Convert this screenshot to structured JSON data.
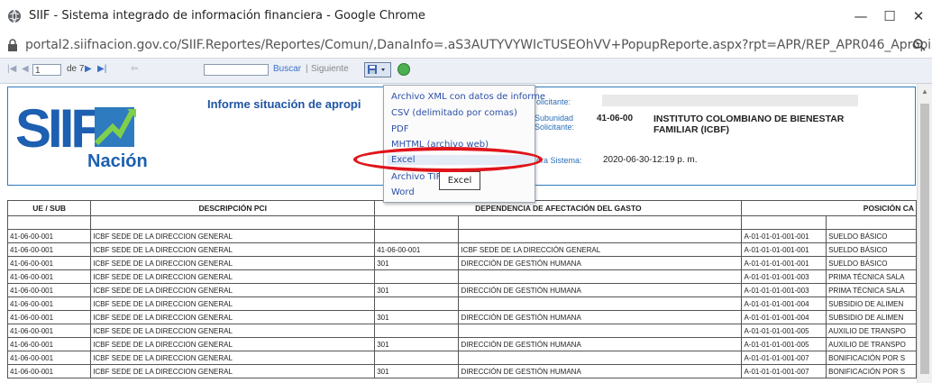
{
  "window": {
    "title": "SIIF - Sistema integrado de información financiera - Google Chrome",
    "controls": {
      "minimize": "—",
      "maximize": "☐",
      "close": "✕"
    }
  },
  "address": {
    "url": "portal2.siifnacion.gov.co/SIIF.Reportes/Reportes/Comun/,DanaInfo=.aS3AUTYVYWIcTUSEOhVV+PopupReporte.aspx?rpt=APR/REP_APR046_Apropia..."
  },
  "toolbar": {
    "page_current": "1",
    "page_total": "de 7",
    "find_label": "Buscar",
    "separator": "|",
    "next_label": "Siguiente"
  },
  "export_menu": {
    "items": [
      "Archivo XML con datos de informe",
      "CSV (delimitado por comas)",
      "PDF",
      "MHTML (archivo web)",
      "Excel",
      "Archivo TIFF",
      "Word"
    ],
    "selected": "Excel",
    "tooltip": "Excel",
    "highlight_color": "#e0141a"
  },
  "header": {
    "logo_text": "SIIF",
    "logo_subtext": "Nación",
    "title": "Informe situación de apropi",
    "labels": {
      "solicitante": "olicitante:",
      "subunidad": "Subunidad",
      "sub_solicitante": "Solicitante:",
      "hora": "ora Sistema:"
    },
    "subunidad_code": "41-06-00",
    "entity_name": "INSTITUTO COLOMBIANO DE BIENESTAR FAMILIAR (ICBF)",
    "system_time": "2020-06-30-12:19 p. m."
  },
  "table": {
    "columns": [
      "UE / SUB",
      "DESCRIPCIÓN PCI",
      "DEPENDENCIA DE AFECTACIÓN DEL GASTO",
      "POSICIÓN CA"
    ],
    "rows": [
      [
        "41-06-00-001",
        "ICBF SEDE DE LA DIRECCION GENERAL",
        "",
        "",
        "A-01-01-01-001-001",
        "SUELDO BÁSICO"
      ],
      [
        "41-06-00-001",
        "ICBF SEDE DE LA DIRECCION GENERAL",
        "41-06-00-001",
        "ICBF SEDE DE LA DIRECCIÓN GENERAL",
        "A-01-01-01-001-001",
        "SUELDO BÁSICO"
      ],
      [
        "41-06-00-001",
        "ICBF SEDE DE LA DIRECCION GENERAL",
        "301",
        "DIRECCIÓN DE GESTIÓN HUMANA",
        "A-01-01-01-001-001",
        "SUELDO BÁSICO"
      ],
      [
        "41-06-00-001",
        "ICBF SEDE DE LA DIRECCION GENERAL",
        "",
        "",
        "A-01-01-01-001-003",
        "PRIMA TÉCNICA SALA"
      ],
      [
        "41-06-00-001",
        "ICBF SEDE DE LA DIRECCION GENERAL",
        "301",
        "DIRECCIÓN DE GESTIÓN HUMANA",
        "A-01-01-01-001-003",
        "PRIMA TÉCNICA SALA"
      ],
      [
        "41-06-00-001",
        "ICBF SEDE DE LA DIRECCION GENERAL",
        "",
        "",
        "A-01-01-01-001-004",
        "SUBSIDIO DE ALIMEN"
      ],
      [
        "41-06-00-001",
        "ICBF SEDE DE LA DIRECCION GENERAL",
        "301",
        "DIRECCIÓN DE GESTIÓN HUMANA",
        "A-01-01-01-001-004",
        "SUBSIDIO DE ALIMEN"
      ],
      [
        "41-06-00-001",
        "ICBF SEDE DE LA DIRECCION GENERAL",
        "",
        "",
        "A-01-01-01-001-005",
        "AUXILIO DE TRANSPO"
      ],
      [
        "41-06-00-001",
        "ICBF SEDE DE LA DIRECCION GENERAL",
        "301",
        "DIRECCIÓN DE GESTIÓN HUMANA",
        "A-01-01-01-001-005",
        "AUXILIO DE TRANSPO"
      ],
      [
        "41-06-00-001",
        "ICBF SEDE DE LA DIRECCION GENERAL",
        "",
        "",
        "A-01-01-01-001-007",
        "BONIFICACIÓN POR S"
      ],
      [
        "41-06-00-001",
        "ICBF SEDE DE LA DIRECCION GENERAL",
        "301",
        "DIRECCIÓN DE GESTIÓN HUMANA",
        "A-01-01-01-001-007",
        "BONIFICACIÓN POR S"
      ]
    ]
  }
}
